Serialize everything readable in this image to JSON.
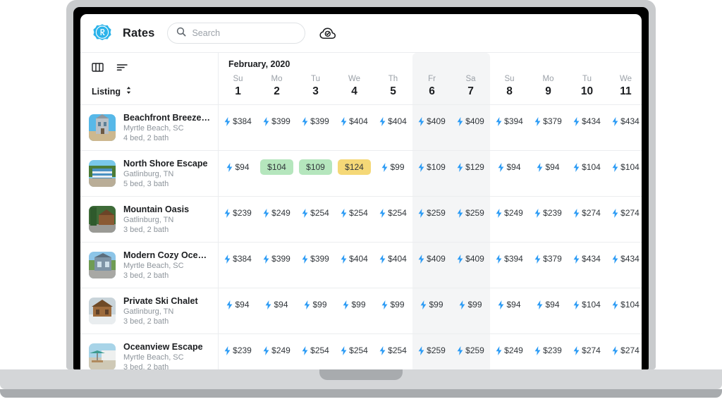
{
  "header": {
    "app_title": "Rates",
    "logo_icon": "rates-logo-icon",
    "search_placeholder": "Search",
    "search_value": "",
    "search_icon": "search-icon",
    "cloud_icon": "cloud-check-icon"
  },
  "toolbar": {
    "columns_icon": "columns-icon",
    "sort_icon": "sort-icon",
    "group_by_label": "Listing",
    "group_by_chevron_icon": "chevron-up-down-icon"
  },
  "calendar": {
    "month_label": "February, 2020",
    "weekend_highlight_color": "#f4f5f6",
    "days": [
      {
        "dow": "Su",
        "num": "1",
        "weekend": false
      },
      {
        "dow": "Mo",
        "num": "2",
        "weekend": false
      },
      {
        "dow": "Tu",
        "num": "3",
        "weekend": false
      },
      {
        "dow": "We",
        "num": "4",
        "weekend": false
      },
      {
        "dow": "Th",
        "num": "5",
        "weekend": false
      },
      {
        "dow": "Fr",
        "num": "6",
        "weekend": true
      },
      {
        "dow": "Sa",
        "num": "7",
        "weekend": true
      },
      {
        "dow": "Su",
        "num": "8",
        "weekend": false
      },
      {
        "dow": "Mo",
        "num": "9",
        "weekend": false
      },
      {
        "dow": "Tu",
        "num": "10",
        "weekend": false
      },
      {
        "dow": "We",
        "num": "11",
        "weekend": false
      }
    ]
  },
  "colors": {
    "accent_blue": "#2d9cf5",
    "pill_green": "#b5e6bd",
    "pill_amber": "#f5d877",
    "text_primary": "#1b1d20",
    "text_muted": "#8d949b"
  },
  "listings": [
    {
      "name": "Beachfront Breeze Villa",
      "location": "Myrtle Beach, SC",
      "beds": "4 bed, 2 bath",
      "thumb": "beachfront-breeze-villa-photo",
      "rates": [
        {
          "price": "$384",
          "style": "plain"
        },
        {
          "price": "$399",
          "style": "plain"
        },
        {
          "price": "$399",
          "style": "plain"
        },
        {
          "price": "$404",
          "style": "plain"
        },
        {
          "price": "$404",
          "style": "plain"
        },
        {
          "price": "$409",
          "style": "plain"
        },
        {
          "price": "$409",
          "style": "plain"
        },
        {
          "price": "$394",
          "style": "plain"
        },
        {
          "price": "$379",
          "style": "plain"
        },
        {
          "price": "$434",
          "style": "plain"
        },
        {
          "price": "$434",
          "style": "plain"
        }
      ]
    },
    {
      "name": "North Shore Escape",
      "location": "Gatlinburg, TN",
      "beds": "5 bed, 3 bath",
      "thumb": "north-shore-escape-photo",
      "rates": [
        {
          "price": "$94",
          "style": "plain"
        },
        {
          "price": "$104",
          "style": "green"
        },
        {
          "price": "$109",
          "style": "green"
        },
        {
          "price": "$124",
          "style": "amber"
        },
        {
          "price": "$99",
          "style": "plain"
        },
        {
          "price": "$109",
          "style": "plain"
        },
        {
          "price": "$129",
          "style": "plain"
        },
        {
          "price": "$94",
          "style": "plain"
        },
        {
          "price": "$94",
          "style": "plain"
        },
        {
          "price": "$104",
          "style": "plain"
        },
        {
          "price": "$104",
          "style": "plain"
        }
      ]
    },
    {
      "name": "Mountain Oasis",
      "location": "Gatlinburg, TN",
      "beds": "3 bed, 2 bath",
      "thumb": "mountain-oasis-photo",
      "rates": [
        {
          "price": "$239",
          "style": "plain"
        },
        {
          "price": "$249",
          "style": "plain"
        },
        {
          "price": "$254",
          "style": "plain"
        },
        {
          "price": "$254",
          "style": "plain"
        },
        {
          "price": "$254",
          "style": "plain"
        },
        {
          "price": "$259",
          "style": "plain"
        },
        {
          "price": "$259",
          "style": "plain"
        },
        {
          "price": "$249",
          "style": "plain"
        },
        {
          "price": "$239",
          "style": "plain"
        },
        {
          "price": "$274",
          "style": "plain"
        },
        {
          "price": "$274",
          "style": "plain"
        }
      ]
    },
    {
      "name": "Modern Cozy Oceanfr...",
      "location": "Myrtle Beach, SC",
      "beds": "3 bed, 2 bath",
      "thumb": "modern-cozy-oceanfront-photo",
      "rates": [
        {
          "price": "$384",
          "style": "plain"
        },
        {
          "price": "$399",
          "style": "plain"
        },
        {
          "price": "$399",
          "style": "plain"
        },
        {
          "price": "$404",
          "style": "plain"
        },
        {
          "price": "$404",
          "style": "plain"
        },
        {
          "price": "$409",
          "style": "plain"
        },
        {
          "price": "$409",
          "style": "plain"
        },
        {
          "price": "$394",
          "style": "plain"
        },
        {
          "price": "$379",
          "style": "plain"
        },
        {
          "price": "$434",
          "style": "plain"
        },
        {
          "price": "$434",
          "style": "plain"
        }
      ]
    },
    {
      "name": "Private Ski Chalet",
      "location": "Gatlinburg, TN",
      "beds": "3 bed, 2 bath",
      "thumb": "private-ski-chalet-photo",
      "rates": [
        {
          "price": "$94",
          "style": "plain"
        },
        {
          "price": "$94",
          "style": "plain"
        },
        {
          "price": "$99",
          "style": "plain"
        },
        {
          "price": "$99",
          "style": "plain"
        },
        {
          "price": "$99",
          "style": "plain"
        },
        {
          "price": "$99",
          "style": "plain"
        },
        {
          "price": "$99",
          "style": "plain"
        },
        {
          "price": "$94",
          "style": "plain"
        },
        {
          "price": "$94",
          "style": "plain"
        },
        {
          "price": "$104",
          "style": "plain"
        },
        {
          "price": "$104",
          "style": "plain"
        }
      ]
    },
    {
      "name": "Oceanview Escape",
      "location": "Myrtle Beach, SC",
      "beds": "3 bed, 2 bath",
      "thumb": "oceanview-escape-photo",
      "rates": [
        {
          "price": "$239",
          "style": "plain"
        },
        {
          "price": "$249",
          "style": "plain"
        },
        {
          "price": "$254",
          "style": "plain"
        },
        {
          "price": "$254",
          "style": "plain"
        },
        {
          "price": "$254",
          "style": "plain"
        },
        {
          "price": "$259",
          "style": "plain"
        },
        {
          "price": "$259",
          "style": "plain"
        },
        {
          "price": "$249",
          "style": "plain"
        },
        {
          "price": "$239",
          "style": "plain"
        },
        {
          "price": "$274",
          "style": "plain"
        },
        {
          "price": "$274",
          "style": "plain"
        }
      ]
    }
  ]
}
